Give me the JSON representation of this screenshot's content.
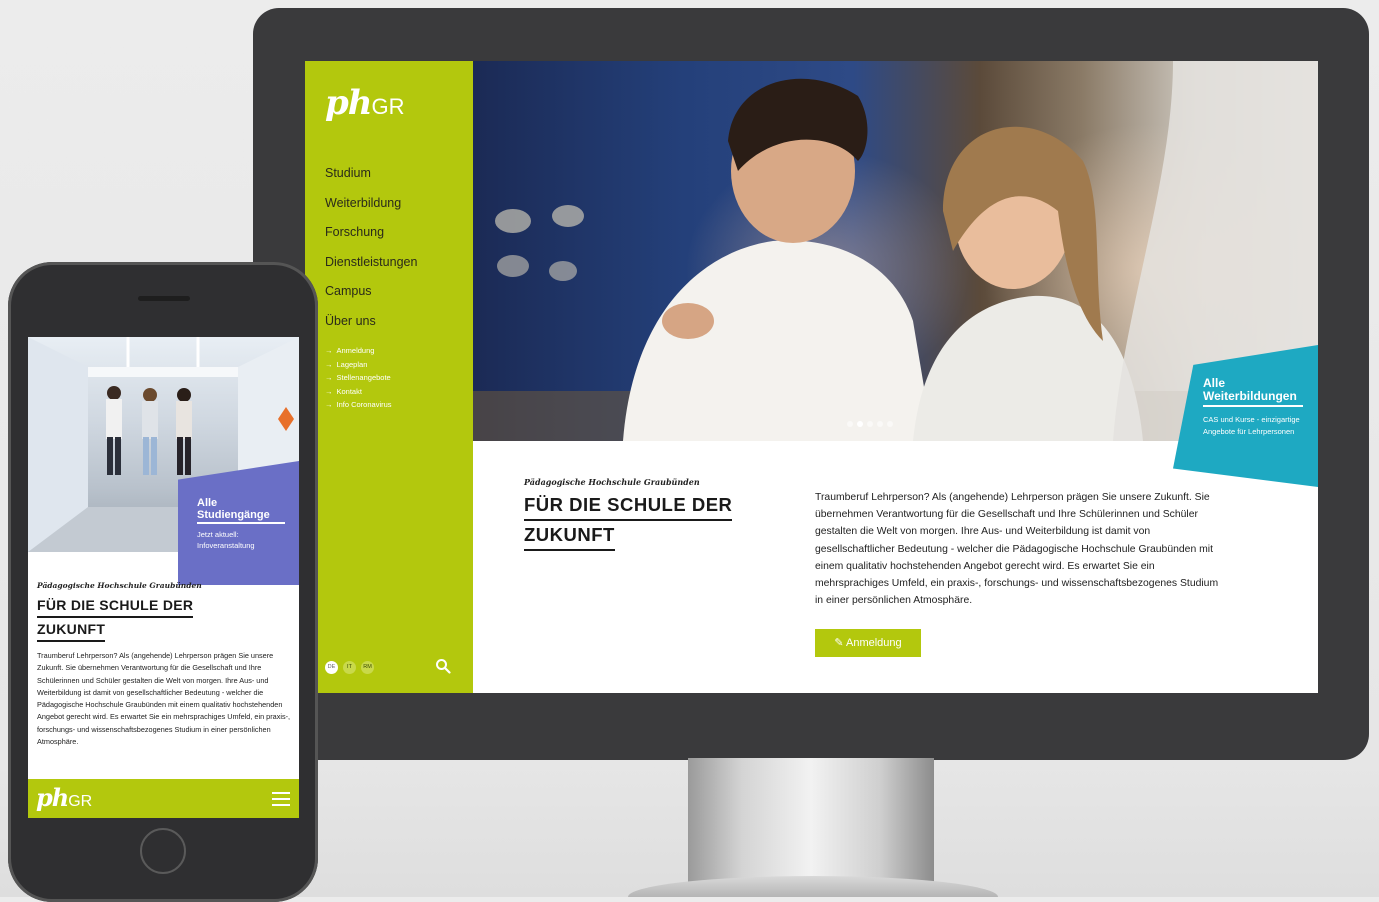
{
  "colors": {
    "brand_green": "#b3c80d",
    "promo_teal": "#1ea9c2",
    "promo_purple": "#6a6fc6",
    "device_dark": "#3a3a3c"
  },
  "desktop": {
    "logo": {
      "ph": "ph",
      "gr": "GR"
    },
    "nav": [
      "Studium",
      "Weiterbildung",
      "Forschung",
      "Dienstleistungen",
      "Campus",
      "Über uns"
    ],
    "subnav": [
      "Anmeldung",
      "Lageplan",
      "Stellenangebote",
      "Kontakt",
      "Info Coronavirus"
    ],
    "languages": [
      "DE",
      "IT",
      "RM"
    ],
    "search_icon": "search-icon",
    "hero": {
      "slides": 5,
      "active_slide": 2
    },
    "promo": {
      "title_line1": "Alle",
      "title_line2": "Weiterbildungen",
      "text": "CAS und Kurse - einzigartige Angebote für Lehrpersonen"
    },
    "kicker": "Pädagogische Hochschule Graubünden",
    "headline_line1": "FÜR DIE SCHULE DER",
    "headline_line2": "ZUKUNFT",
    "body": "Traumberuf Lehrperson? Als (angehende) Lehrperson prägen Sie unsere Zukunft. Sie übernehmen Verantwortung für die Gesellschaft und Ihre Schülerinnen und Schüler gestalten die Welt von morgen. Ihre Aus- und Weiterbildung ist damit von gesellschaftlicher Bedeutung - welcher die Pädagogische Hochschule Graubünden mit einem qualitativ hochstehenden Angebot gerecht wird. Es erwartet Sie ein mehrsprachiges Umfeld, ein praxis-, forschungs- und wissenschaftsbezogenes Studium in einer persönlichen Atmosphäre.",
    "button_label": "Anmeldung",
    "button_icon": "pencil-icon"
  },
  "mobile": {
    "promo": {
      "title_line1": "Alle",
      "title_line2": "Studiengänge",
      "text": "Jetzt aktuell: Infoveranstaltung"
    },
    "kicker": "Pädagogische Hochschule Graubünden",
    "headline_line1": "FÜR DIE SCHULE DER",
    "headline_line2": "ZUKUNFT",
    "body": "Traumberuf Lehrperson? Als (angehende) Lehrperson prägen Sie unsere Zukunft. Sie übernehmen Verantwortung für die Gesellschaft und Ihre Schülerinnen und Schüler gestalten die Welt von morgen. Ihre Aus- und Weiterbildung ist damit von gesellschaftlicher Bedeutung - welcher die Pädagogische Hochschule Graubünden mit einem qualitativ hochstehenden Angebot gerecht wird. Es erwartet Sie ein mehrsprachiges Umfeld, ein praxis-, forschungs- und wissenschaftsbezogenes Studium in einer persönlichen Atmosphäre.",
    "logo": {
      "ph": "ph",
      "gr": "GR"
    },
    "menu_icon": "hamburger-menu-icon"
  }
}
